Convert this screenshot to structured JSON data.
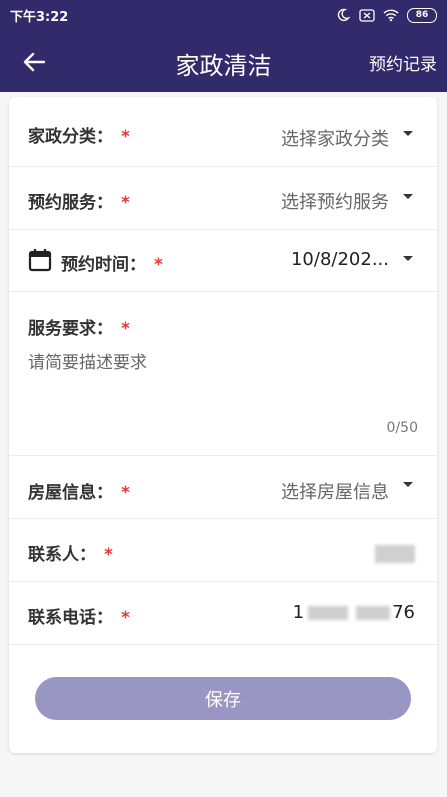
{
  "status_bar": {
    "time": "下午3:22",
    "battery": "86"
  },
  "app_bar": {
    "title": "家政清洁",
    "action": "预约记录"
  },
  "form": {
    "category": {
      "label": "家政分类：",
      "placeholder": "选择家政分类"
    },
    "service": {
      "label": "预约服务：",
      "placeholder": "选择预约服务"
    },
    "time": {
      "label": "预约时间：",
      "value": "10/8/202..."
    },
    "requirement": {
      "label": "服务要求：",
      "placeholder": "请简要描述要求",
      "counter": "0/50"
    },
    "house": {
      "label": "房屋信息：",
      "placeholder": "选择房屋信息"
    },
    "contact": {
      "label": "联系人："
    },
    "phone": {
      "label": "联系电话：",
      "prefix": "1",
      "suffix": "76"
    },
    "required_mark": "*",
    "save_label": "保存"
  },
  "colors": {
    "primary": "#312b6b",
    "button": "#9a96c4",
    "required": "#e53935"
  }
}
